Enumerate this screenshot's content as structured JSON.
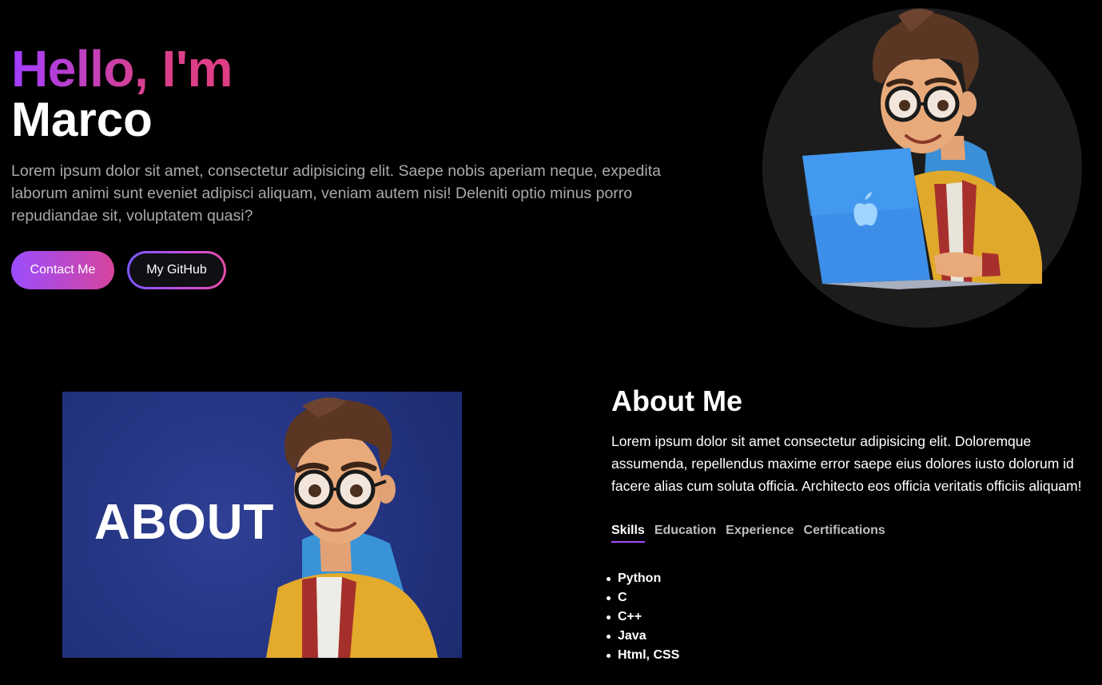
{
  "hero": {
    "greeting": "Hello, I'm",
    "name": "Marco",
    "description": "Lorem ipsum dolor sit amet, consectetur adipisicing elit. Saepe nobis aperiam neque, expedita laborum animi sunt eveniet adipisci aliquam, veniam autem nisi! Deleniti optio minus porro repudiandae sit, voluptatem quasi?",
    "contact_button": "Contact Me",
    "github_button": "My GitHub"
  },
  "about": {
    "image_word": "ABOUT",
    "title": "About Me",
    "description": "Lorem ipsum dolor sit amet consectetur adipisicing elit. Doloremque assumenda, repellendus maxime error saepe eius dolores iusto dolorum id facere alias cum soluta officia. Architecto eos officia veritatis officiis aliquam!",
    "tabs": [
      {
        "label": "Skills",
        "active": true
      },
      {
        "label": "Education",
        "active": false
      },
      {
        "label": "Experience",
        "active": false
      },
      {
        "label": "Certifications",
        "active": false
      }
    ],
    "skills": [
      "Python",
      "C",
      "C++",
      "Java",
      "Html, CSS"
    ]
  },
  "colors": {
    "background": "#000000",
    "accent_purple": "#a23dff",
    "accent_pink": "#d8408c",
    "muted_text": "#a9a9a9",
    "about_image_bg": "#23337f"
  },
  "icons": [
    "cartoon-avatar-laptop",
    "apple-logo-icon",
    "cartoon-avatar-about"
  ]
}
